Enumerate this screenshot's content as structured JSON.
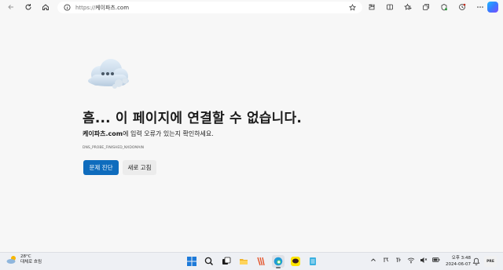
{
  "browser": {
    "url_protocol": "https://",
    "url_host": "케이파츠.com"
  },
  "error": {
    "title": "흠... 이 페이지에 연결할 수 없습니다.",
    "desc_site": "케이파츠.com",
    "desc_rest": "에 입력 오류가 있는지 확인하세요.",
    "code": "DNS_PROBE_FINISHED_NXDOMAIN",
    "diagnose_label": "문제 진단",
    "reload_label": "새로 고침"
  },
  "taskbar": {
    "temp": "28°C",
    "condition": "대체로 흐림",
    "time": "오후 3:48",
    "date": "2024-06-07",
    "pre_label": "PRE"
  },
  "colors": {
    "primary_button": "#0f6cbd",
    "page_bg": "#f7f7f7"
  }
}
